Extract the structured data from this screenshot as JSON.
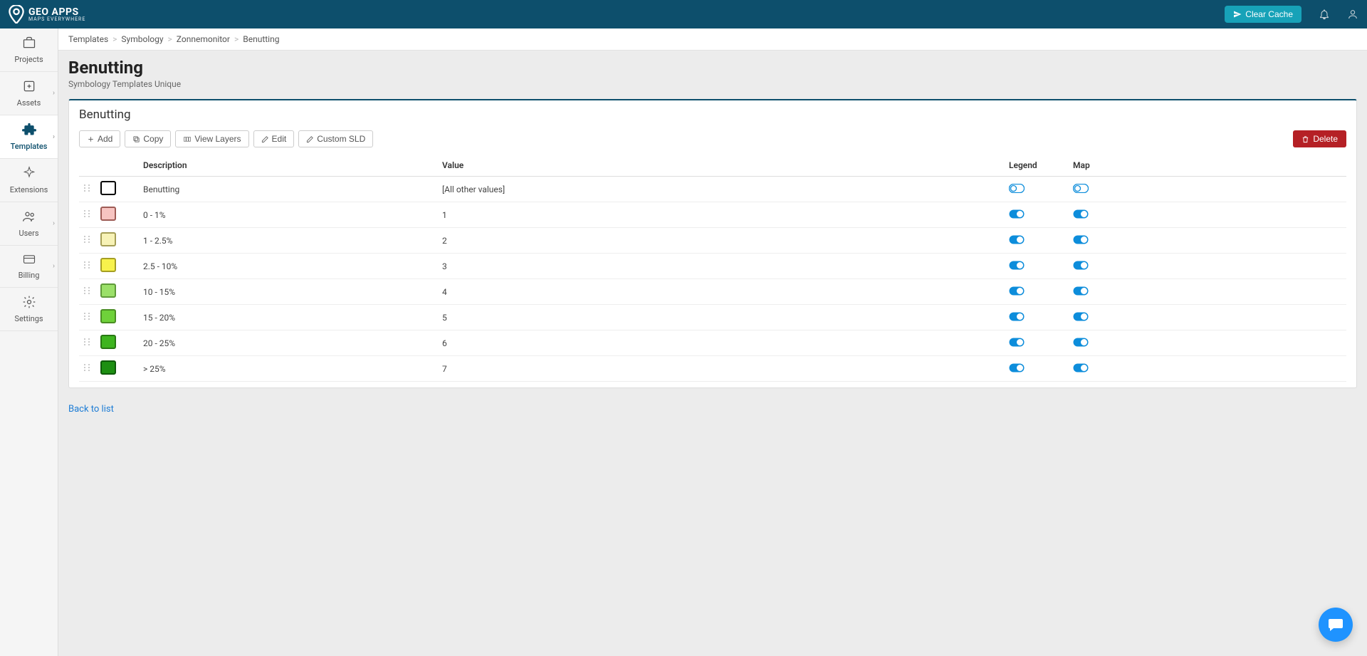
{
  "brand": {
    "name": "GEO APPS",
    "tagline": "MAPS EVERYWHERE"
  },
  "header": {
    "clear_cache": "Clear Cache"
  },
  "sidebar": {
    "items": [
      {
        "label": "Projects",
        "icon": "briefcase",
        "chevron": false,
        "active": false
      },
      {
        "label": "Assets",
        "icon": "plus-box",
        "chevron": true,
        "active": false
      },
      {
        "label": "Templates",
        "icon": "puzzle",
        "chevron": true,
        "active": true
      },
      {
        "label": "Extensions",
        "icon": "sparkle",
        "chevron": false,
        "active": false
      },
      {
        "label": "Users",
        "icon": "users",
        "chevron": true,
        "active": false
      },
      {
        "label": "Billing",
        "icon": "card",
        "chevron": true,
        "active": false
      },
      {
        "label": "Settings",
        "icon": "gear",
        "chevron": false,
        "active": false
      }
    ]
  },
  "breadcrumb": [
    "Templates",
    "Symbology",
    "Zonnemonitor",
    "Benutting"
  ],
  "page": {
    "title": "Benutting",
    "subtitle": "Symbology Templates Unique",
    "panel_title": "Benutting"
  },
  "toolbar": {
    "add": "Add",
    "copy": "Copy",
    "view_layers": "View Layers",
    "edit": "Edit",
    "custom_sld": "Custom SLD",
    "delete": "Delete"
  },
  "table": {
    "headers": {
      "description": "Description",
      "value": "Value",
      "legend": "Legend",
      "map": "Map"
    },
    "rows": [
      {
        "swatch_fill": "#ffffff",
        "swatch_border": "#000000",
        "description": "Benutting",
        "value": "[All other values]",
        "legend": false,
        "map": false
      },
      {
        "swatch_fill": "#f7c4c1",
        "swatch_border": "#9e5b55",
        "description": "0 - 1%",
        "value": "1",
        "legend": true,
        "map": true
      },
      {
        "swatch_fill": "#f7f2b6",
        "swatch_border": "#a59e56",
        "description": "1 - 2.5%",
        "value": "2",
        "legend": true,
        "map": true
      },
      {
        "swatch_fill": "#f7f24c",
        "swatch_border": "#a59e24",
        "description": "2.5 - 10%",
        "value": "3",
        "legend": true,
        "map": true
      },
      {
        "swatch_fill": "#9be069",
        "swatch_border": "#5f9a3a",
        "description": "10 - 15%",
        "value": "4",
        "legend": true,
        "map": true
      },
      {
        "swatch_fill": "#6fd13a",
        "swatch_border": "#4a8e23",
        "description": "15 - 20%",
        "value": "5",
        "legend": true,
        "map": true
      },
      {
        "swatch_fill": "#3eb41f",
        "swatch_border": "#287813",
        "description": "20 - 25%",
        "value": "6",
        "legend": true,
        "map": true
      },
      {
        "swatch_fill": "#1d8f12",
        "swatch_border": "#0e5a0a",
        "description": "> 25%",
        "value": "7",
        "legend": true,
        "map": true
      }
    ]
  },
  "back_link": "Back to list"
}
